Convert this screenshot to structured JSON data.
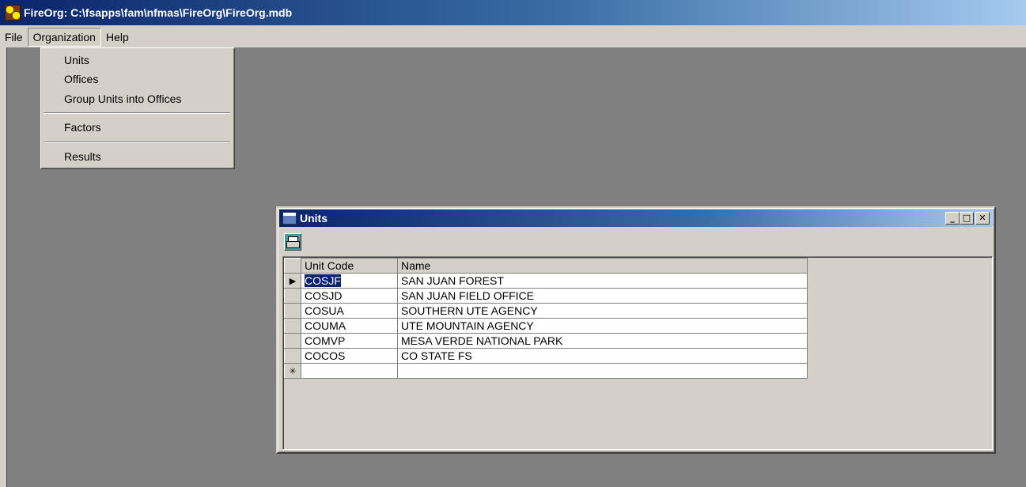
{
  "window": {
    "title": "FireOrg: C:\\fsapps\\fam\\nfmas\\FireOrg\\FireOrg.mdb"
  },
  "menubar": {
    "items": [
      "File",
      "Organization",
      "Help"
    ]
  },
  "organization_menu": {
    "group1": [
      "Units",
      "Offices",
      "Group Units into Offices"
    ],
    "group2": [
      "Factors"
    ],
    "group3": [
      "Results"
    ]
  },
  "units_window": {
    "title": "Units",
    "controls": {
      "minimize": "_",
      "maximize": "□",
      "close": "✕"
    },
    "columns": [
      "Unit Code",
      "Name"
    ],
    "rows": [
      {
        "code": "COSJF",
        "name": "SAN JUAN FOREST"
      },
      {
        "code": "COSJD",
        "name": "SAN JUAN FIELD OFFICE"
      },
      {
        "code": "COSUA",
        "name": "SOUTHERN UTE AGENCY"
      },
      {
        "code": "COUMA",
        "name": "UTE MOUNTAIN AGENCY"
      },
      {
        "code": "COMVP",
        "name": "MESA VERDE NATIONAL PARK"
      },
      {
        "code": "COCOS",
        "name": "CO STATE FS"
      }
    ],
    "current_row_marker": "▶",
    "new_row_marker": "✳"
  }
}
